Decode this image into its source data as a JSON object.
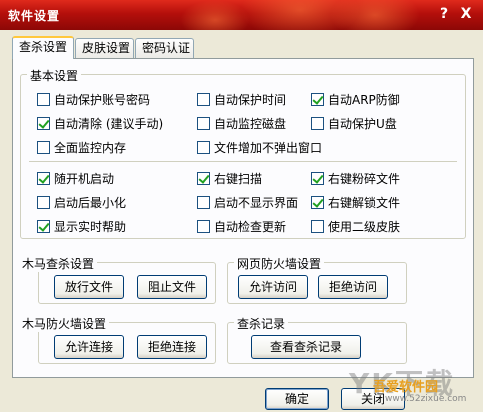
{
  "window": {
    "title": "软件设置",
    "help_glyph": "?",
    "close_glyph": "X"
  },
  "tabs": [
    {
      "label": "查杀设置",
      "active": true
    },
    {
      "label": "皮肤设置",
      "active": false
    },
    {
      "label": "密码认证",
      "active": false
    }
  ],
  "basic": {
    "title": "基本设置",
    "options_top": [
      {
        "label": "自动保护账号密码",
        "checked": false
      },
      {
        "label": "自动保护时间",
        "checked": false
      },
      {
        "label": "自动ARP防御",
        "checked": true
      },
      {
        "label": "自动清除 (建议手动)",
        "checked": true
      },
      {
        "label": "自动监控磁盘",
        "checked": false
      },
      {
        "label": "自动保护U盘",
        "checked": false
      },
      {
        "label": "全面监控内存",
        "checked": false
      },
      {
        "label": "文件增加不弹出窗口",
        "checked": false
      }
    ],
    "options_bottom": [
      {
        "label": "随开机启动",
        "checked": true
      },
      {
        "label": "右键扫描",
        "checked": true
      },
      {
        "label": "右键粉碎文件",
        "checked": true
      },
      {
        "label": "启动后最小化",
        "checked": false
      },
      {
        "label": "启动不显示界面",
        "checked": false
      },
      {
        "label": "右键解锁文件",
        "checked": true
      },
      {
        "label": "显示实时帮助",
        "checked": true
      },
      {
        "label": "自动检查更新",
        "checked": false
      },
      {
        "label": "使用二级皮肤",
        "checked": false
      }
    ]
  },
  "trojan": {
    "title": "木马查杀设置",
    "allow_label": "放行文件",
    "block_label": "阻止文件"
  },
  "web_firewall": {
    "title": "网页防火墙设置",
    "allow_label": "允许访问",
    "deny_label": "拒绝访问"
  },
  "trojan_firewall": {
    "title": "木马防火墙设置",
    "allow_label": "允许连接",
    "deny_label": "拒绝连接"
  },
  "scan_log": {
    "title": "查杀记录",
    "view_label": "查看查杀记录"
  },
  "footer": {
    "ok_label": "确定",
    "close_label": "关闭"
  },
  "watermark": {
    "big": "YK下载",
    "site": "吾爱软件园",
    "url": "www.52zixue.com"
  },
  "colors": {
    "titlebar": "#b40f0b",
    "check": "#21a121",
    "tab_highlight": "#ffc83c"
  }
}
